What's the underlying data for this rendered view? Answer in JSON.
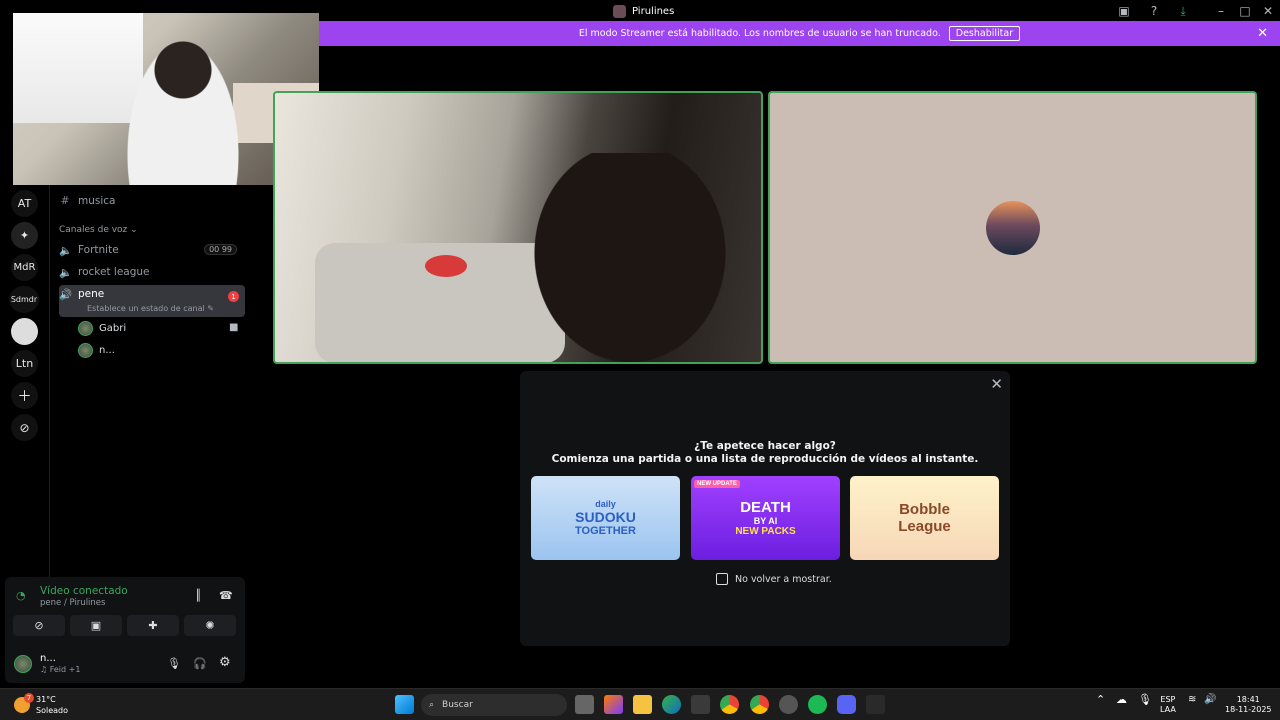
{
  "window": {
    "title": "Pirulines"
  },
  "banner": {
    "text": "El modo Streamer está habilitado. Los nombres de usuario se han truncado.",
    "button": "Deshabilitar"
  },
  "servers": {
    "items": [
      "AT",
      "MdR",
      "Sdmdr",
      "Ltn"
    ]
  },
  "channels": {
    "text_channel": "musica",
    "category": "Canales de voz",
    "voice": [
      {
        "name": "Fortnite",
        "pill": "00 99"
      },
      {
        "name": "rocket league"
      },
      {
        "name": "pene",
        "badge": "1",
        "status": "Establece un estado de canal"
      }
    ],
    "users": [
      "Gabri",
      "n..."
    ]
  },
  "voice_panel": {
    "title": "Vídeo conectado",
    "subtitle": "pene / Pirulines",
    "user_name": "n...",
    "user_status": "♫ Feid +1"
  },
  "activity": {
    "question": "¿Te apetece hacer algo?",
    "subtitle": "Comienza una partida o una lista de reproducción de vídeos al instante.",
    "games": [
      {
        "line1": "daily",
        "line2": "SUDOKU",
        "line3": "TOGETHER"
      },
      {
        "tag": "NEW UPDATE",
        "line1": "DEATH",
        "line2": "BY AI",
        "line3": "NEW PACKS"
      },
      {
        "line1": "Bobble",
        "line2": "League"
      }
    ],
    "checkbox_label": "No volver a mostrar."
  },
  "taskbar": {
    "weather_temp": "31°C",
    "weather_desc": "Soleado",
    "weather_badge": "7",
    "search_placeholder": "Buscar",
    "lang1": "ESP",
    "lang2": "LAA",
    "time": "18:41",
    "date": "18-11-2025"
  }
}
